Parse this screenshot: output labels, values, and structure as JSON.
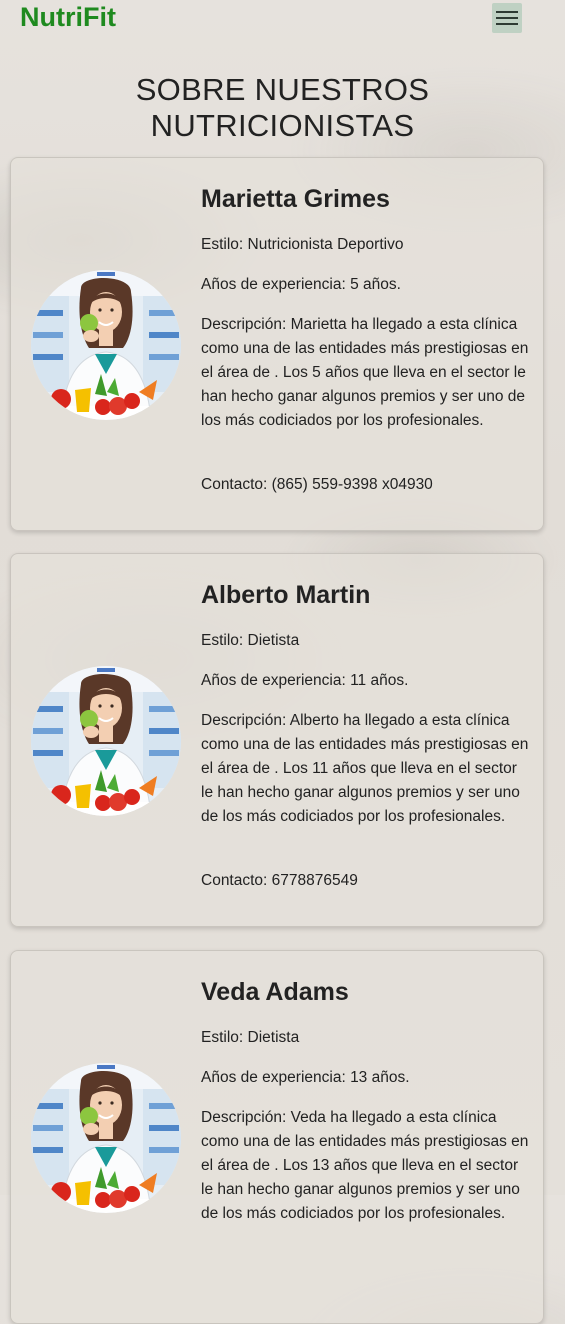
{
  "header": {
    "brand": "NutriFit",
    "menu_icon": "hamburger-menu-icon",
    "brand_color": "#1f8a1f"
  },
  "page": {
    "title": "SOBRE NUESTROS NUTRICIONISTAS"
  },
  "nutritionists": [
    {
      "name": "Marietta Grimes",
      "style": "Estilo: Nutricionista Deportivo",
      "experience": "Años de experiencia: 5 años.",
      "description": "Descripción: Marietta ha llegado a esta clínica como una de las entidades más prestigiosas en el área de . Los 5 años que lleva en el sector le han hecho ganar algunos premios y ser uno de los más codiciados por los profesionales.",
      "contact": "Contacto: (865) 559-9398 x04930"
    },
    {
      "name": "Alberto Martin",
      "style": "Estilo: Dietista",
      "experience": "Años de experiencia: 11 años.",
      "description": "Descripción: Alberto ha llegado a esta clínica como una de las entidades más prestigiosas en el área de . Los 11 años que lleva en el sector le han hecho ganar algunos premios y ser uno de los más codiciados por los profesionales.",
      "contact": "Contacto: 6778876549"
    },
    {
      "name": "Veda Adams",
      "style": "Estilo: Dietista",
      "experience": "Años de experiencia: 13 años.",
      "description": "Descripción: Veda ha llegado a esta clínica como una de las entidades más prestigiosas en el área de . Los 13 años que lleva en el sector le han hecho ganar algunos premios y ser uno de los más codiciados por los profesionales.",
      "contact": ""
    }
  ]
}
